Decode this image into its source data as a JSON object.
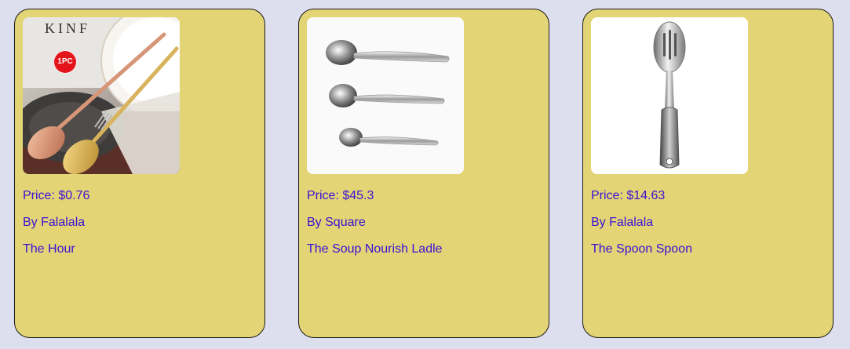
{
  "products": [
    {
      "badge": "1PC",
      "price_label": "Price: $0.76",
      "brand_label": "By Falalala",
      "name": "The Hour"
    },
    {
      "price_label": "Price: $45.3",
      "brand_label": "By Square",
      "name": "The Soup Nourish Ladle"
    },
    {
      "price_label": "Price: $14.63",
      "brand_label": "By Falalala",
      "name": "The Spoon Spoon"
    }
  ],
  "colors": {
    "page_background": "#dddfee",
    "card_background": "#e3d475",
    "text_accent": "#3b10d6",
    "badge_red": "#e4141b"
  }
}
